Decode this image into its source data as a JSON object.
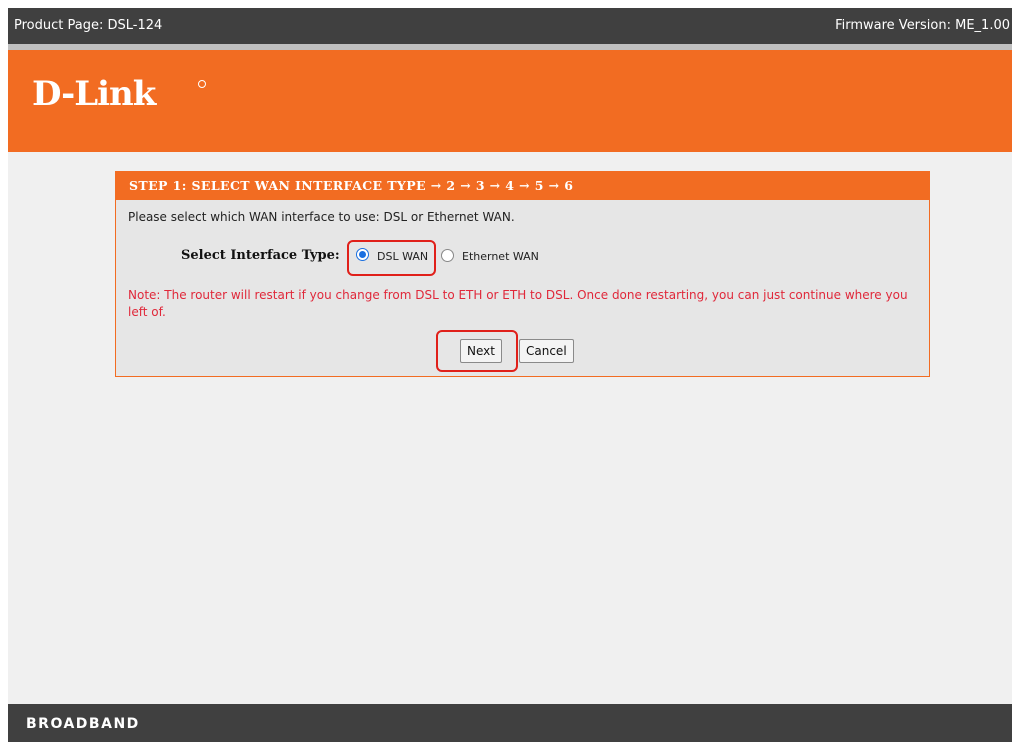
{
  "topbar": {
    "product": "Product Page: DSL-124",
    "firmware": "Firmware Version: ME_1.00"
  },
  "brand": {
    "logo": "D-Link",
    "color": "#f26c22"
  },
  "wizard": {
    "header": "STEP 1: SELECT WAN INTERFACE TYPE → 2 → 3 → 4 → 5 → 6",
    "intro": "Please select which WAN interface to use: DSL or Ethernet WAN.",
    "interface_label": "Select Interface Type:",
    "options": [
      {
        "label": "DSL WAN",
        "selected": true
      },
      {
        "label": "Ethernet WAN",
        "selected": false
      }
    ],
    "note": "Note: The router will restart if you change from DSL to ETH or ETH to DSL. Once done restarting, you can just continue where you left of.",
    "next_label": "Next",
    "cancel_label": "Cancel"
  },
  "footer": {
    "text": "BROADBAND"
  }
}
